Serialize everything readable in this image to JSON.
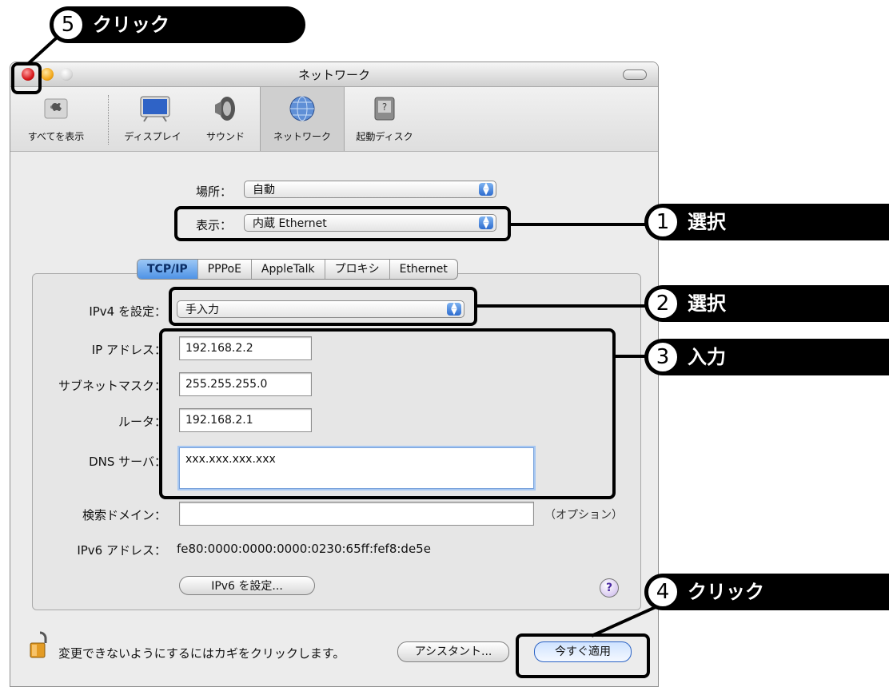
{
  "window": {
    "title": "ネットワーク"
  },
  "toolbar": {
    "items": [
      {
        "label": "すべてを表示",
        "icon": "apple-grid-icon"
      },
      {
        "label": "ディスプレイ",
        "icon": "display-icon"
      },
      {
        "label": "サウンド",
        "icon": "speaker-icon"
      },
      {
        "label": "ネットワーク",
        "icon": "globe-icon"
      },
      {
        "label": "起動ディスク",
        "icon": "startup-disk-icon"
      }
    ]
  },
  "location": {
    "label": "場所：",
    "value": "自動"
  },
  "show": {
    "label": "表示：",
    "value": "内蔵 Ethernet"
  },
  "tabs": [
    "TCP/IP",
    "PPPoE",
    "AppleTalk",
    "プロキシ",
    "Ethernet"
  ],
  "ipv4": {
    "config_label": "IPv4 を設定：",
    "config_value": "手入力",
    "ip_label": "IP アドレス：",
    "ip_value": "192.168.2.2",
    "subnet_label": "サブネットマスク：",
    "subnet_value": "255.255.255.0",
    "router_label": "ルータ：",
    "router_value": "192.168.2.1",
    "dns_label": "DNS サーバ：",
    "dns_value": "xxx.xxx.xxx.xxx",
    "search_label": "検索ドメイン：",
    "search_value": "",
    "search_hint": "（オプション）",
    "ipv6_label": "IPv6 アドレス：",
    "ipv6_value": "fe80:0000:0000:0000:0230:65ff:fef8:de5e",
    "ipv6_button": "IPv6 を設定...",
    "help": "?"
  },
  "footer": {
    "lock_text": "変更できないようにするにはカギをクリックします。",
    "assistant_button": "アシスタント...",
    "apply_button": "今すぐ適用"
  },
  "annotations": [
    {
      "num": "1",
      "text": "選択"
    },
    {
      "num": "2",
      "text": "選択"
    },
    {
      "num": "3",
      "text": "入力"
    },
    {
      "num": "4",
      "text": "クリック"
    },
    {
      "num": "5",
      "text": "クリック"
    }
  ],
  "colors": {
    "accent": "#4f93e6",
    "callout": "#000000",
    "close": "#d6171b"
  }
}
